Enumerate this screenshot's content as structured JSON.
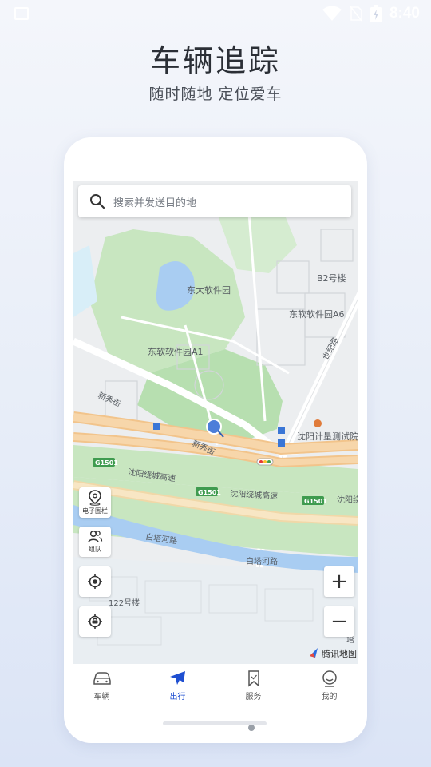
{
  "status": {
    "time": "8:40"
  },
  "hero": {
    "title": "车辆追踪",
    "subtitle": "随时随地 定位爱车"
  },
  "search": {
    "placeholder": "搜索并发送目的地"
  },
  "map_labels": {
    "park": "东大软件园",
    "b2": "B2号楼",
    "a6": "东软软件园A6",
    "a1": "东软软件园A1",
    "xinxiu1": "新秀街",
    "xinxiu2": "新秀街",
    "shiji": "世纪路",
    "institute": "沈阳计量测试院",
    "g1501_a": "G1501",
    "g1501_b": "G1501",
    "g1501_c": "G1501",
    "ring1": "沈阳绕城高速",
    "ring2": "沈阳绕城高速",
    "ring3": "沈阳绕",
    "baita1": "白塔河路",
    "baita2": "白塔河路",
    "building122": "122号楼",
    "ta": "塔",
    "logo": "腾讯地图"
  },
  "tools": {
    "fence": "电子围栏",
    "team": "组队"
  },
  "zoom": {
    "in": "+",
    "out": "−"
  },
  "tabs": [
    {
      "label": "车辆",
      "icon": "car-icon"
    },
    {
      "label": "出行",
      "icon": "plane-icon"
    },
    {
      "label": "服务",
      "icon": "bookmark-icon"
    },
    {
      "label": "我的",
      "icon": "smile-icon"
    }
  ],
  "colors": {
    "accent": "#1f4fd1",
    "highway": "#f5c98e",
    "park": "#c8e6c0",
    "water": "#a9cdf2"
  }
}
